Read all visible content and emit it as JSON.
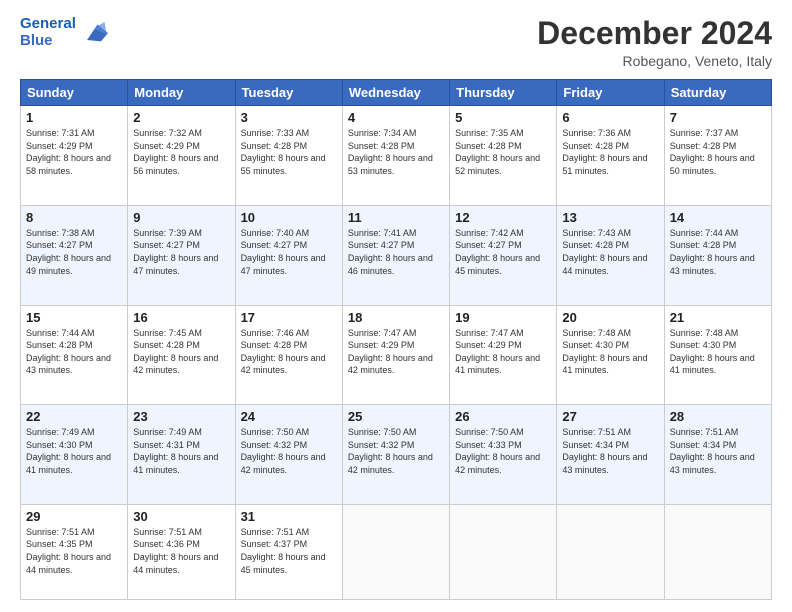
{
  "header": {
    "logo_line1": "General",
    "logo_line2": "Blue",
    "month_title": "December 2024",
    "subtitle": "Robegano, Veneto, Italy"
  },
  "weekdays": [
    "Sunday",
    "Monday",
    "Tuesday",
    "Wednesday",
    "Thursday",
    "Friday",
    "Saturday"
  ],
  "weeks": [
    [
      {
        "day": "1",
        "sunrise": "Sunrise: 7:31 AM",
        "sunset": "Sunset: 4:29 PM",
        "daylight": "Daylight: 8 hours and 58 minutes."
      },
      {
        "day": "2",
        "sunrise": "Sunrise: 7:32 AM",
        "sunset": "Sunset: 4:29 PM",
        "daylight": "Daylight: 8 hours and 56 minutes."
      },
      {
        "day": "3",
        "sunrise": "Sunrise: 7:33 AM",
        "sunset": "Sunset: 4:28 PM",
        "daylight": "Daylight: 8 hours and 55 minutes."
      },
      {
        "day": "4",
        "sunrise": "Sunrise: 7:34 AM",
        "sunset": "Sunset: 4:28 PM",
        "daylight": "Daylight: 8 hours and 53 minutes."
      },
      {
        "day": "5",
        "sunrise": "Sunrise: 7:35 AM",
        "sunset": "Sunset: 4:28 PM",
        "daylight": "Daylight: 8 hours and 52 minutes."
      },
      {
        "day": "6",
        "sunrise": "Sunrise: 7:36 AM",
        "sunset": "Sunset: 4:28 PM",
        "daylight": "Daylight: 8 hours and 51 minutes."
      },
      {
        "day": "7",
        "sunrise": "Sunrise: 7:37 AM",
        "sunset": "Sunset: 4:28 PM",
        "daylight": "Daylight: 8 hours and 50 minutes."
      }
    ],
    [
      {
        "day": "8",
        "sunrise": "Sunrise: 7:38 AM",
        "sunset": "Sunset: 4:27 PM",
        "daylight": "Daylight: 8 hours and 49 minutes."
      },
      {
        "day": "9",
        "sunrise": "Sunrise: 7:39 AM",
        "sunset": "Sunset: 4:27 PM",
        "daylight": "Daylight: 8 hours and 47 minutes."
      },
      {
        "day": "10",
        "sunrise": "Sunrise: 7:40 AM",
        "sunset": "Sunset: 4:27 PM",
        "daylight": "Daylight: 8 hours and 47 minutes."
      },
      {
        "day": "11",
        "sunrise": "Sunrise: 7:41 AM",
        "sunset": "Sunset: 4:27 PM",
        "daylight": "Daylight: 8 hours and 46 minutes."
      },
      {
        "day": "12",
        "sunrise": "Sunrise: 7:42 AM",
        "sunset": "Sunset: 4:27 PM",
        "daylight": "Daylight: 8 hours and 45 minutes."
      },
      {
        "day": "13",
        "sunrise": "Sunrise: 7:43 AM",
        "sunset": "Sunset: 4:28 PM",
        "daylight": "Daylight: 8 hours and 44 minutes."
      },
      {
        "day": "14",
        "sunrise": "Sunrise: 7:44 AM",
        "sunset": "Sunset: 4:28 PM",
        "daylight": "Daylight: 8 hours and 43 minutes."
      }
    ],
    [
      {
        "day": "15",
        "sunrise": "Sunrise: 7:44 AM",
        "sunset": "Sunset: 4:28 PM",
        "daylight": "Daylight: 8 hours and 43 minutes."
      },
      {
        "day": "16",
        "sunrise": "Sunrise: 7:45 AM",
        "sunset": "Sunset: 4:28 PM",
        "daylight": "Daylight: 8 hours and 42 minutes."
      },
      {
        "day": "17",
        "sunrise": "Sunrise: 7:46 AM",
        "sunset": "Sunset: 4:28 PM",
        "daylight": "Daylight: 8 hours and 42 minutes."
      },
      {
        "day": "18",
        "sunrise": "Sunrise: 7:47 AM",
        "sunset": "Sunset: 4:29 PM",
        "daylight": "Daylight: 8 hours and 42 minutes."
      },
      {
        "day": "19",
        "sunrise": "Sunrise: 7:47 AM",
        "sunset": "Sunset: 4:29 PM",
        "daylight": "Daylight: 8 hours and 41 minutes."
      },
      {
        "day": "20",
        "sunrise": "Sunrise: 7:48 AM",
        "sunset": "Sunset: 4:30 PM",
        "daylight": "Daylight: 8 hours and 41 minutes."
      },
      {
        "day": "21",
        "sunrise": "Sunrise: 7:48 AM",
        "sunset": "Sunset: 4:30 PM",
        "daylight": "Daylight: 8 hours and 41 minutes."
      }
    ],
    [
      {
        "day": "22",
        "sunrise": "Sunrise: 7:49 AM",
        "sunset": "Sunset: 4:30 PM",
        "daylight": "Daylight: 8 hours and 41 minutes."
      },
      {
        "day": "23",
        "sunrise": "Sunrise: 7:49 AM",
        "sunset": "Sunset: 4:31 PM",
        "daylight": "Daylight: 8 hours and 41 minutes."
      },
      {
        "day": "24",
        "sunrise": "Sunrise: 7:50 AM",
        "sunset": "Sunset: 4:32 PM",
        "daylight": "Daylight: 8 hours and 42 minutes."
      },
      {
        "day": "25",
        "sunrise": "Sunrise: 7:50 AM",
        "sunset": "Sunset: 4:32 PM",
        "daylight": "Daylight: 8 hours and 42 minutes."
      },
      {
        "day": "26",
        "sunrise": "Sunrise: 7:50 AM",
        "sunset": "Sunset: 4:33 PM",
        "daylight": "Daylight: 8 hours and 42 minutes."
      },
      {
        "day": "27",
        "sunrise": "Sunrise: 7:51 AM",
        "sunset": "Sunset: 4:34 PM",
        "daylight": "Daylight: 8 hours and 43 minutes."
      },
      {
        "day": "28",
        "sunrise": "Sunrise: 7:51 AM",
        "sunset": "Sunset: 4:34 PM",
        "daylight": "Daylight: 8 hours and 43 minutes."
      }
    ],
    [
      {
        "day": "29",
        "sunrise": "Sunrise: 7:51 AM",
        "sunset": "Sunset: 4:35 PM",
        "daylight": "Daylight: 8 hours and 44 minutes."
      },
      {
        "day": "30",
        "sunrise": "Sunrise: 7:51 AM",
        "sunset": "Sunset: 4:36 PM",
        "daylight": "Daylight: 8 hours and 44 minutes."
      },
      {
        "day": "31",
        "sunrise": "Sunrise: 7:51 AM",
        "sunset": "Sunset: 4:37 PM",
        "daylight": "Daylight: 8 hours and 45 minutes."
      },
      null,
      null,
      null,
      null
    ]
  ]
}
